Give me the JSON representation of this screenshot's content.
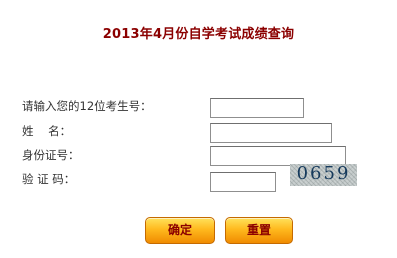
{
  "title": "2013年4月份自学考试成绩查询",
  "form": {
    "exam_no_label": "请输入您的12位考生号：",
    "exam_no_value": "",
    "name_label": "姓    名：",
    "name_value": "",
    "id_label": "身份证号：",
    "id_value": "",
    "captcha_label": "验 证 码：",
    "captcha_value": "",
    "captcha_image_text": "0659"
  },
  "buttons": {
    "submit_label": "确定",
    "reset_label": "重置"
  },
  "colors": {
    "title": "#8b0000",
    "button_top": "#ffe25c",
    "button_bottom": "#f08b00"
  }
}
